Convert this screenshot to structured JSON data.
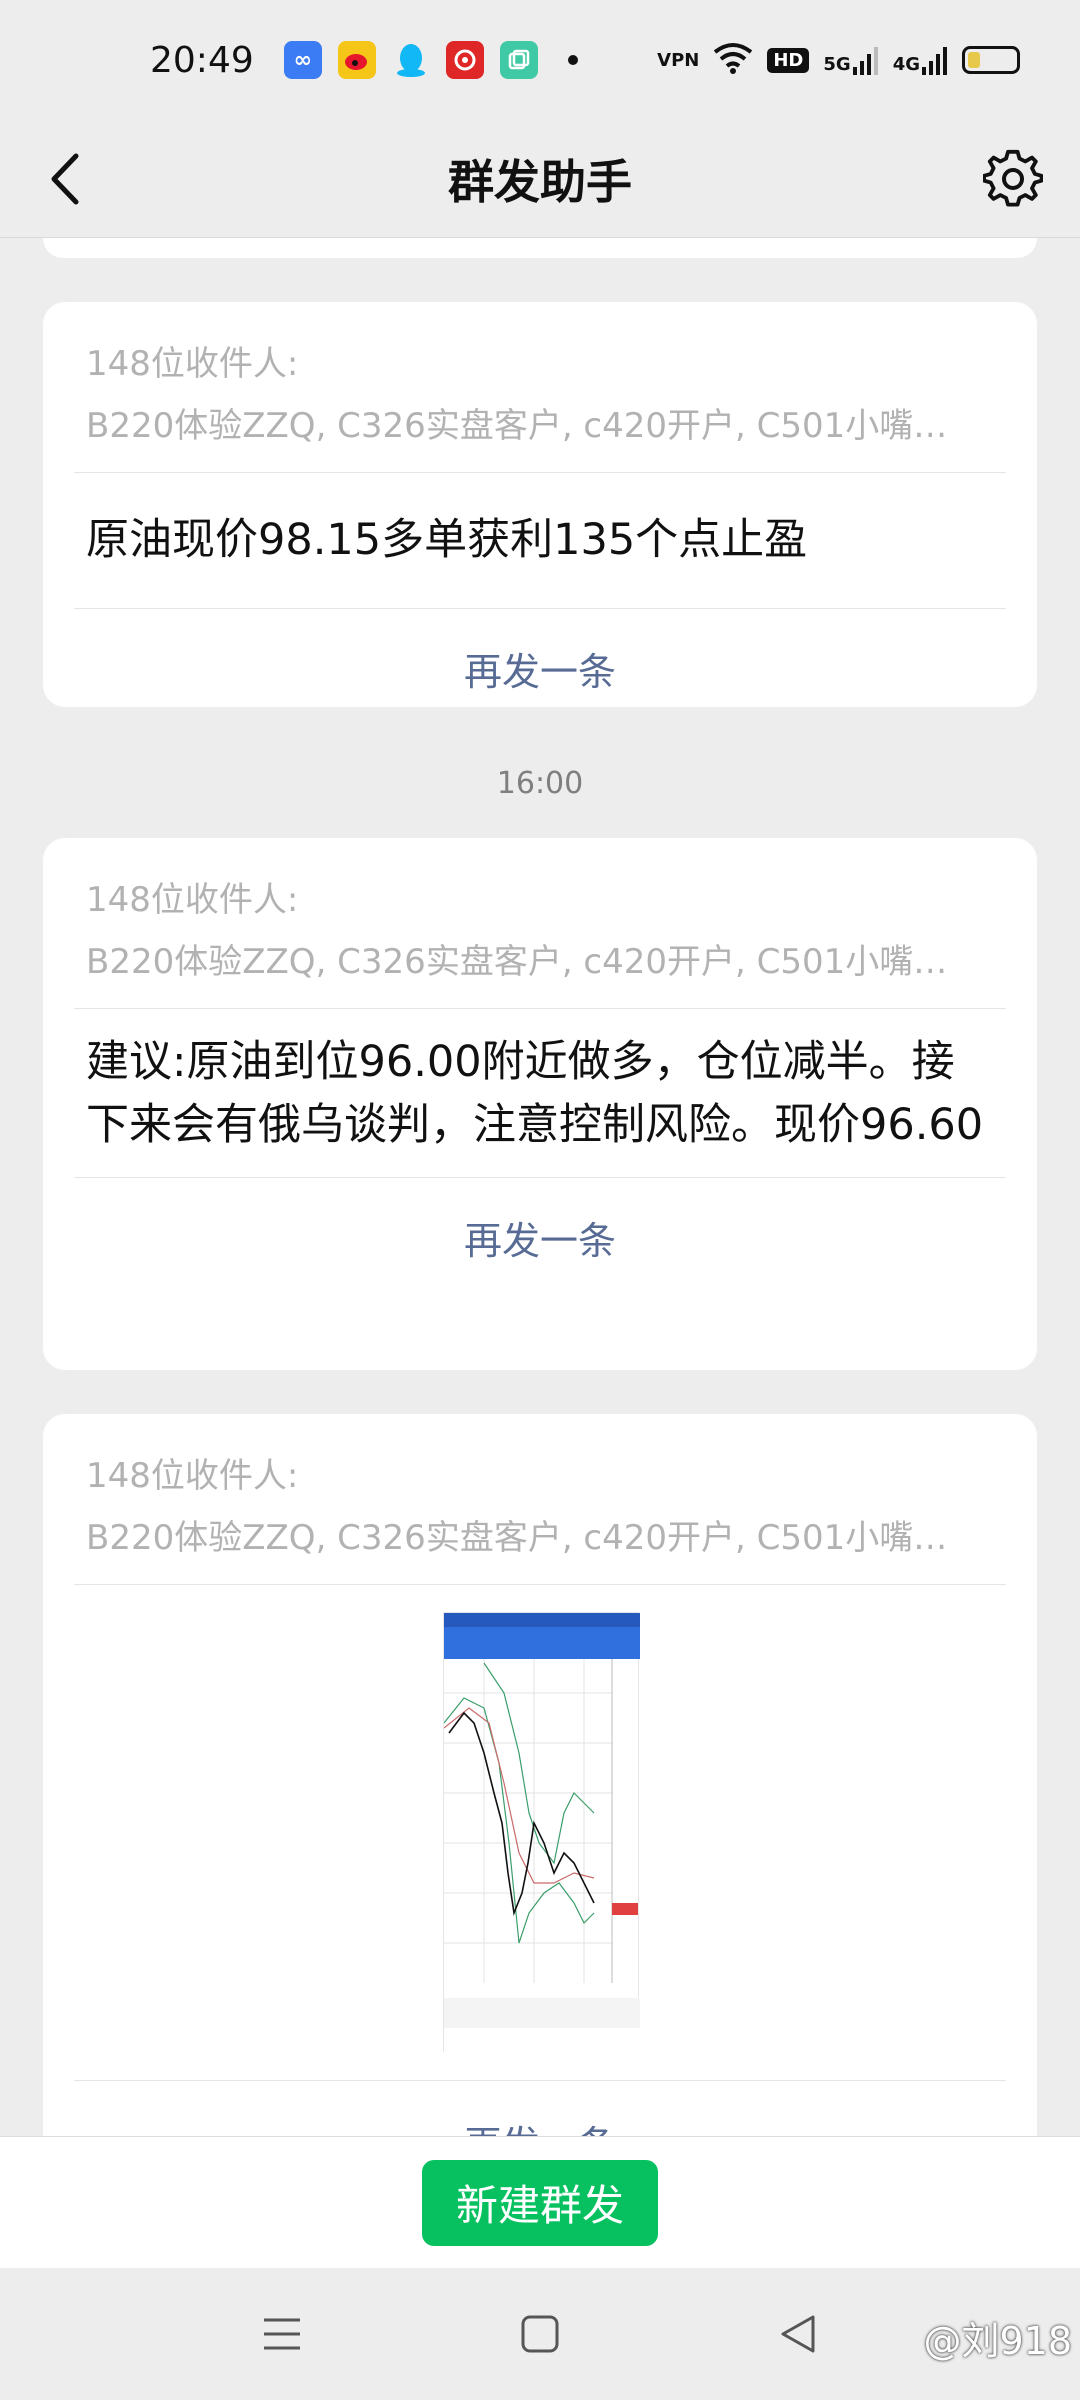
{
  "status_bar": {
    "time": "20:49",
    "app_icons": [
      "infinity-app-icon",
      "weibo-icon",
      "qq-icon",
      "netease-music-icon",
      "gallery-app-icon"
    ],
    "right_labels": {
      "vpn": "VPN",
      "hd": "HD",
      "net1": "5G",
      "net2": "4G"
    }
  },
  "nav": {
    "title": "群发助手"
  },
  "messages": [
    {
      "recipients_label": "148位收件人:",
      "recipients": "B220体验ZZQ, C326实盘客户, c420开户, C501小嘴…",
      "text": "原油现价98.15多单获利135个点止盈",
      "resend": "再发一条"
    },
    {
      "time": "16:00",
      "recipients_label": "148位收件人:",
      "recipients": "B220体验ZZQ, C326实盘客户, c420开户, C501小嘴…",
      "text": "建议:原油到位96.00附近做多，仓位减半。接下来会有俄乌谈判，注意控制风险。现价96.60",
      "resend": "再发一条"
    },
    {
      "recipients_label": "148位收件人:",
      "recipients": "B220体验ZZQ, C326实盘客户, c420开户, C501小嘴…",
      "image": "trading-chart-screenshot",
      "resend": "再发一条"
    }
  ],
  "bottom": {
    "new_button": "新建群发"
  },
  "watermark": "@刘918",
  "colors": {
    "accent_green": "#07c160",
    "link_blue": "#576b95",
    "muted_gray": "#b2b2b2",
    "background": "#ededed"
  }
}
